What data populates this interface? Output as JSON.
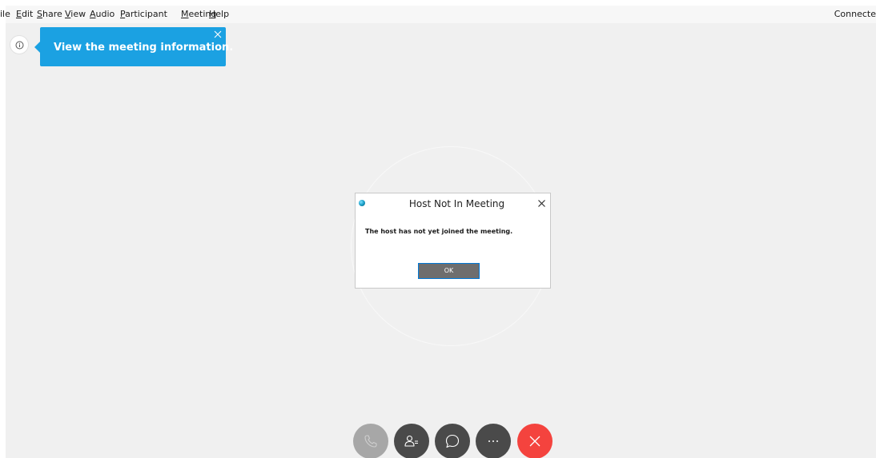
{
  "menu": {
    "items": [
      {
        "text": "ile",
        "underline_first": false
      },
      {
        "text": "Edit",
        "underline_first": true
      },
      {
        "text": "Share",
        "underline_first": true
      },
      {
        "text": "View",
        "underline_first": true
      },
      {
        "text": "Audio",
        "underline_first": true
      },
      {
        "text": "Participant",
        "underline_first": true
      },
      {
        "text": "Meeting",
        "underline_first": true
      },
      {
        "text": "Help",
        "underline_first": true
      }
    ],
    "connection_status": "Connecte"
  },
  "tooltip": {
    "text": "View the meeting information."
  },
  "dialog": {
    "title": "Host Not In Meeting",
    "message": "The host has not yet joined the meeting.",
    "ok_label": "OK"
  },
  "controls": {
    "more_glyph": "···"
  },
  "colors": {
    "tooltip_bg": "#1ba1e2",
    "leave_button": "#f4433e",
    "control_dark": "#4a4a4a",
    "control_disabled": "#a7a7a7",
    "ok_button_bg": "#6e6e6e",
    "ok_button_border": "#0078d7"
  }
}
